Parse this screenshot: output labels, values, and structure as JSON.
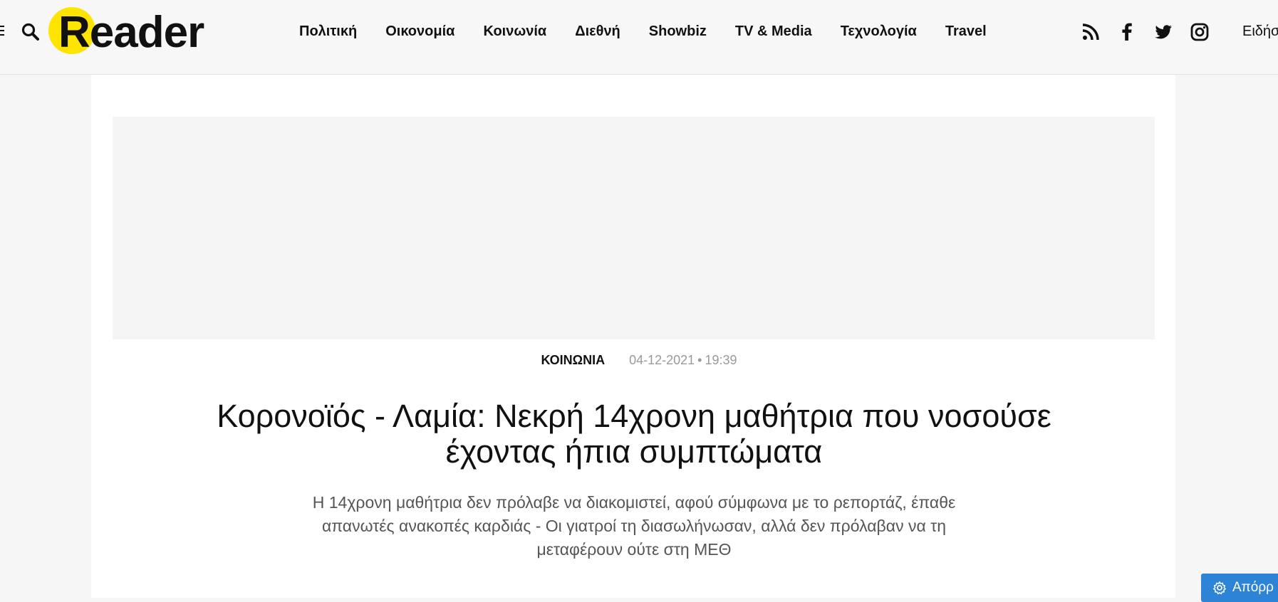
{
  "header": {
    "logo_text": "Reader",
    "icons": {
      "menu": "hamburger-menu-icon",
      "search": "search-icon",
      "rss": "rss-icon",
      "facebook": "facebook-icon",
      "twitter": "twitter-icon",
      "instagram": "instagram-icon"
    },
    "nav": [
      {
        "label": "Πολιτική"
      },
      {
        "label": "Οικονομία"
      },
      {
        "label": "Κοινωνία"
      },
      {
        "label": "Διεθνή"
      },
      {
        "label": "Showbiz"
      },
      {
        "label": "TV & Media"
      },
      {
        "label": "Τεχνολογία"
      },
      {
        "label": "Travel"
      }
    ],
    "news_link": "Ειδήσ"
  },
  "article": {
    "category": "ΚΟΙΝΩΝΙΑ",
    "date": "04-12-2021",
    "separator": "•",
    "time": "19:39",
    "title": "Κορονοϊός - Λαμία: Νεκρή 14χρονη μαθήτρια που νοσούσε έχοντας ήπια συμπτώματα",
    "lede": "Η 14χρονη μαθήτρια δεν πρόλαβε να διακομιστεί, αφού σύμφωνα με το ρεπορτάζ, έπαθε απανωτές ανακοπές καρδιάς - Οι γιατροί τη διασωλήνωσαν, αλλά δεν πρόλαβαν να τη μεταφέρουν ούτε στη ΜΕΘ"
  },
  "privacy_button": {
    "label": "Απόρρ",
    "icon": "gear-icon"
  },
  "colors": {
    "logo_accent": "#ffe400",
    "privacy_button": "#2d83d6",
    "page_background": "#f6f6f6",
    "meta_gray": "#9a9a9a"
  }
}
